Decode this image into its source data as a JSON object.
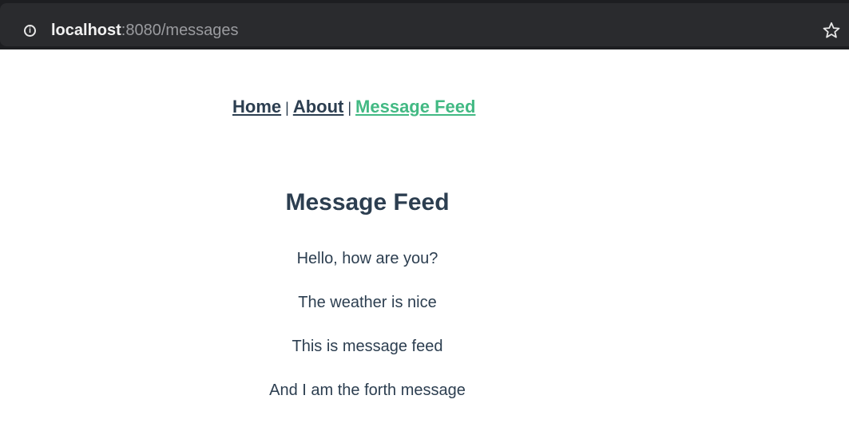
{
  "browser": {
    "url_host": "localhost",
    "url_rest": ":8080/messages",
    "info_icon": "info-icon",
    "bookmark_icon": "star-icon"
  },
  "nav": {
    "home": "Home",
    "about": "About",
    "message_feed": "Message Feed",
    "separator": "|"
  },
  "page": {
    "title": "Message Feed"
  },
  "messages": [
    "Hello, how are you?",
    "The weather is nice",
    "This is message feed",
    "And I am the forth message"
  ],
  "colors": {
    "accent": "#42b983",
    "text": "#2c3e50",
    "browser_bar": "#1d1e21"
  }
}
